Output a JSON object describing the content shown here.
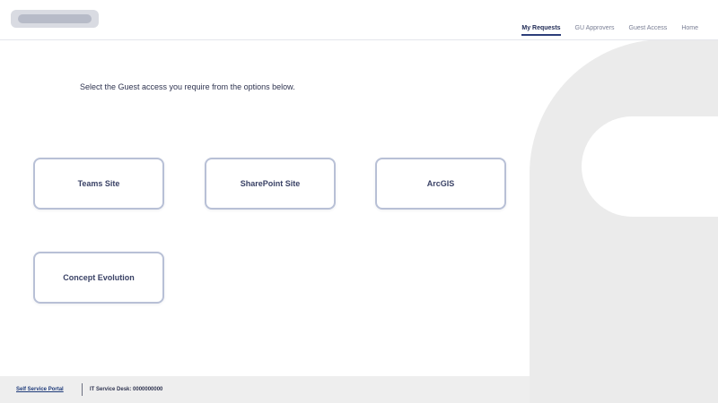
{
  "header": {
    "logo_name": "logo",
    "nav": [
      {
        "label": "My Requests",
        "active": true
      },
      {
        "label": "GU Approvers",
        "active": false
      },
      {
        "label": "Guest Access",
        "active": false
      },
      {
        "label": "Home",
        "active": false
      }
    ]
  },
  "main": {
    "instruction": "Select the Guest access you require from the options below.",
    "options": [
      {
        "label": "Teams Site"
      },
      {
        "label": "SharePoint Site"
      },
      {
        "label": "ArcGIS"
      },
      {
        "label": "Concept Evolution"
      }
    ]
  },
  "footer": {
    "link_label": "Self Service Portal",
    "info_text": "IT Service Desk: 0000000000"
  },
  "colors": {
    "accent": "#2c3e7a",
    "card_border": "#b8c0d6",
    "background_graphic": "#ebebeb"
  }
}
